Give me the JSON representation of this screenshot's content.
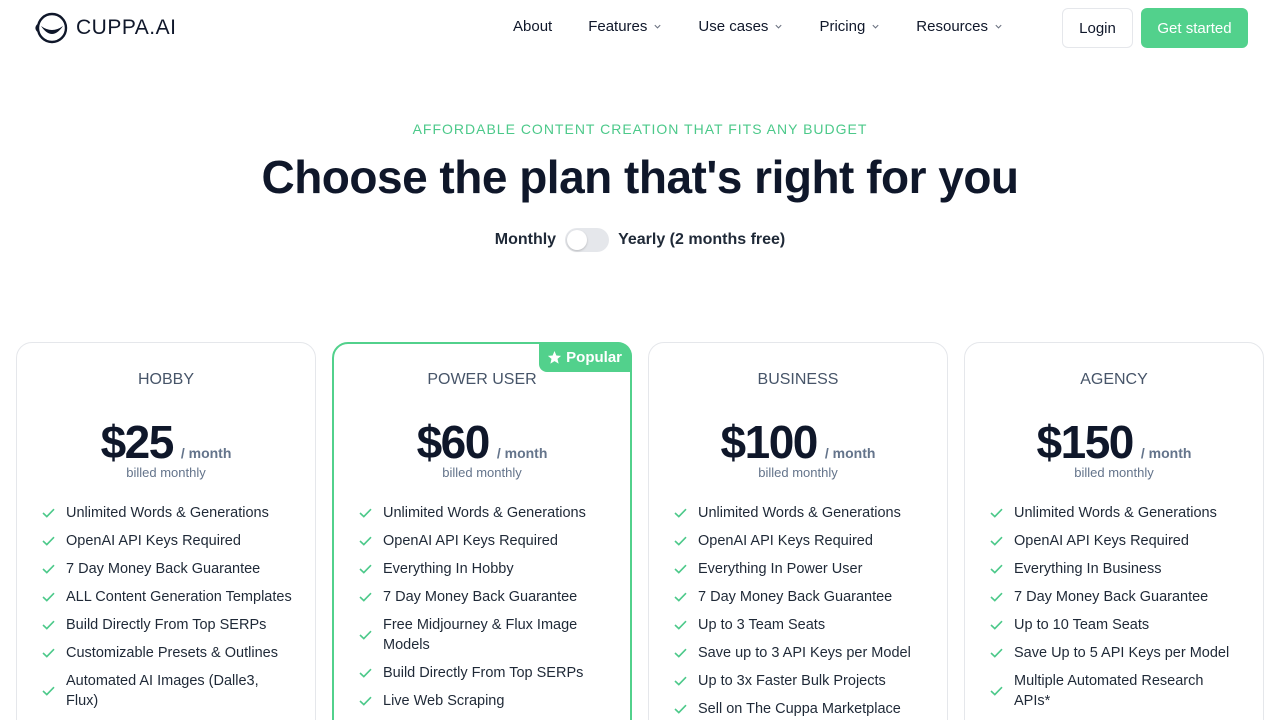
{
  "brand": {
    "name": "CUPPA.AI"
  },
  "nav": {
    "items": [
      {
        "label": "About",
        "dropdown": false
      },
      {
        "label": "Features",
        "dropdown": true
      },
      {
        "label": "Use cases",
        "dropdown": true
      },
      {
        "label": "Pricing",
        "dropdown": true
      },
      {
        "label": "Resources",
        "dropdown": true
      }
    ],
    "login_label": "Login",
    "cta_label": "Get started"
  },
  "hero": {
    "eyebrow": "AFFORDABLE CONTENT CREATION THAT FITS ANY BUDGET",
    "title": "Choose the plan that's right for you",
    "toggle": {
      "left_label": "Monthly",
      "right_label": "Yearly (2 months free)",
      "yearly_selected": false
    }
  },
  "colors": {
    "accent": "#52d18c",
    "text": "#0f172a",
    "muted": "#64748b"
  },
  "plans": [
    {
      "name": "HOBBY",
      "price": "$25",
      "period": "/ month",
      "billing": "billed monthly",
      "popular": false,
      "features": [
        "Unlimited Words & Generations",
        "OpenAI API Keys Required",
        "7 Day Money Back Guarantee",
        "ALL Content Generation Templates",
        "Build Directly From Top SERPs",
        "Customizable Presets & Outlines",
        "Automated AI Images (Dalle3, Flux)"
      ]
    },
    {
      "name": "POWER USER",
      "price": "$60",
      "period": "/ month",
      "billing": "billed monthly",
      "popular": true,
      "badge": "Popular",
      "features": [
        "Unlimited Words & Generations",
        "OpenAI API Keys Required",
        "Everything In Hobby",
        "7 Day Money Back Guarantee",
        "Free Midjourney & Flux Image Models",
        "Build Directly From Top SERPs",
        "Live Web Scraping"
      ]
    },
    {
      "name": "BUSINESS",
      "price": "$100",
      "period": "/ month",
      "billing": "billed monthly",
      "popular": false,
      "features": [
        "Unlimited Words & Generations",
        "OpenAI API Keys Required",
        "Everything In Power User",
        "7 Day Money Back Guarantee",
        "Up to 3 Team Seats",
        "Save up to 3 API Keys per Model",
        "Up to 3x Faster Bulk Projects",
        "Sell on The Cuppa Marketplace"
      ]
    },
    {
      "name": "AGENCY",
      "price": "$150",
      "period": "/ month",
      "billing": "billed monthly",
      "popular": false,
      "features": [
        "Unlimited Words & Generations",
        "OpenAI API Keys Required",
        "Everything In Business",
        "7 Day Money Back Guarantee",
        "Up to 10 Team Seats",
        "Save Up to 5 API Keys per Model",
        "Multiple Automated Research APIs*"
      ]
    }
  ]
}
